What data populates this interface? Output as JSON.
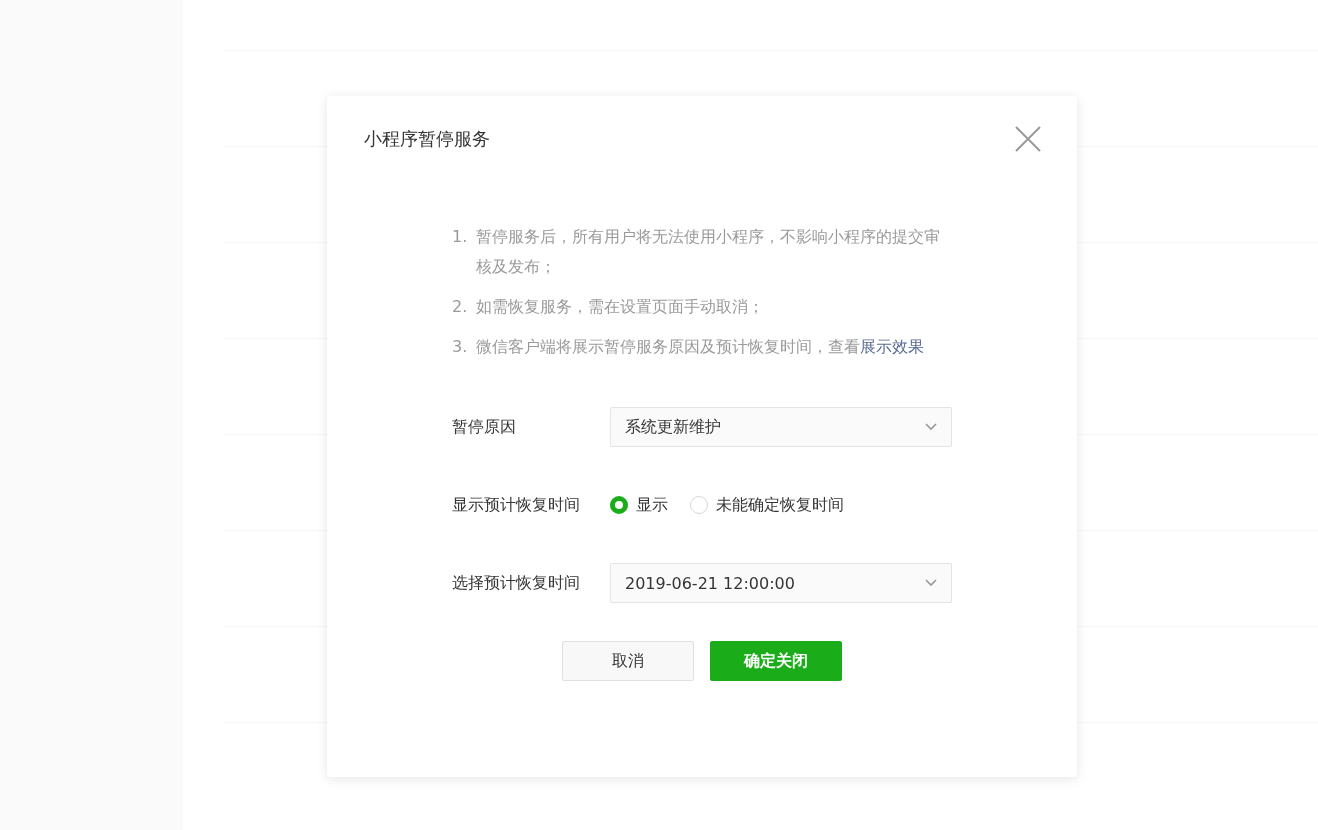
{
  "dialog": {
    "title": "小程序暂停服务",
    "notes": [
      {
        "number": "1.",
        "text": "暂停服务后，所有用户将无法使用小程序，不影响小程序的提交审核及发布；"
      },
      {
        "number": "2.",
        "text": "如需恢复服务，需在设置页面手动取消；"
      },
      {
        "number": "3.",
        "text": "微信客户端将展示暂停服务原因及预计恢复时间，查看",
        "link": "展示效果"
      }
    ],
    "fields": [
      {
        "kind": "select",
        "label": "暂停原因",
        "value": "系统更新维护"
      },
      {
        "kind": "radio",
        "label": "显示预计恢复时间",
        "options": [
          {
            "label": "显示",
            "selected": true
          },
          {
            "label": "未能确定恢复时间",
            "selected": false
          }
        ]
      },
      {
        "kind": "select",
        "label": "选择预计恢复时间",
        "value": "2019-06-21 12:00:00"
      }
    ],
    "buttons": [
      {
        "label": "取消",
        "kind": "secondary"
      },
      {
        "label": "确定关闭",
        "kind": "primary"
      }
    ]
  }
}
